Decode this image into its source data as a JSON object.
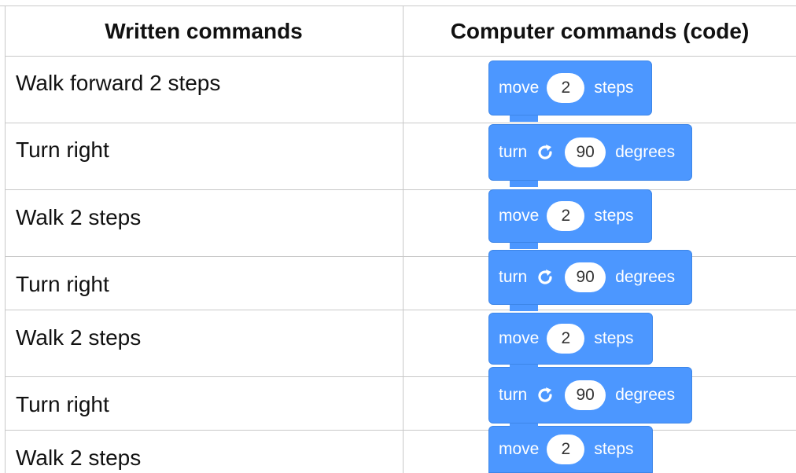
{
  "header": {
    "col1": "Written commands",
    "col2": "Computer commands (code)"
  },
  "rows": [
    {
      "written": "Walk forward 2 steps",
      "code": {
        "kind": "move",
        "kw": "move",
        "value": "2",
        "unit": "steps"
      }
    },
    {
      "written": "Turn right",
      "code": {
        "kind": "turn",
        "kw": "turn",
        "icon": "rotate-right-icon",
        "value": "90",
        "unit": "degrees"
      }
    },
    {
      "written": "Walk 2 steps",
      "code": {
        "kind": "move",
        "kw": "move",
        "value": "2",
        "unit": "steps"
      }
    },
    {
      "written": "Turn right",
      "code": {
        "kind": "turn",
        "kw": "turn",
        "icon": "rotate-right-icon",
        "value": "90",
        "unit": "degrees"
      }
    },
    {
      "written": "Walk 2 steps",
      "code": {
        "kind": "move",
        "kw": "move",
        "value": "2",
        "unit": "steps"
      }
    },
    {
      "written": "Turn right",
      "code": {
        "kind": "turn",
        "kw": "turn",
        "icon": "rotate-right-icon",
        "value": "90",
        "unit": "degrees"
      }
    },
    {
      "written": "Walk 2 steps",
      "code": {
        "kind": "move",
        "kw": "move",
        "value": "2",
        "unit": "steps"
      }
    }
  ],
  "colors": {
    "block": "#4c97ff",
    "grid": "#c8c8c8"
  }
}
